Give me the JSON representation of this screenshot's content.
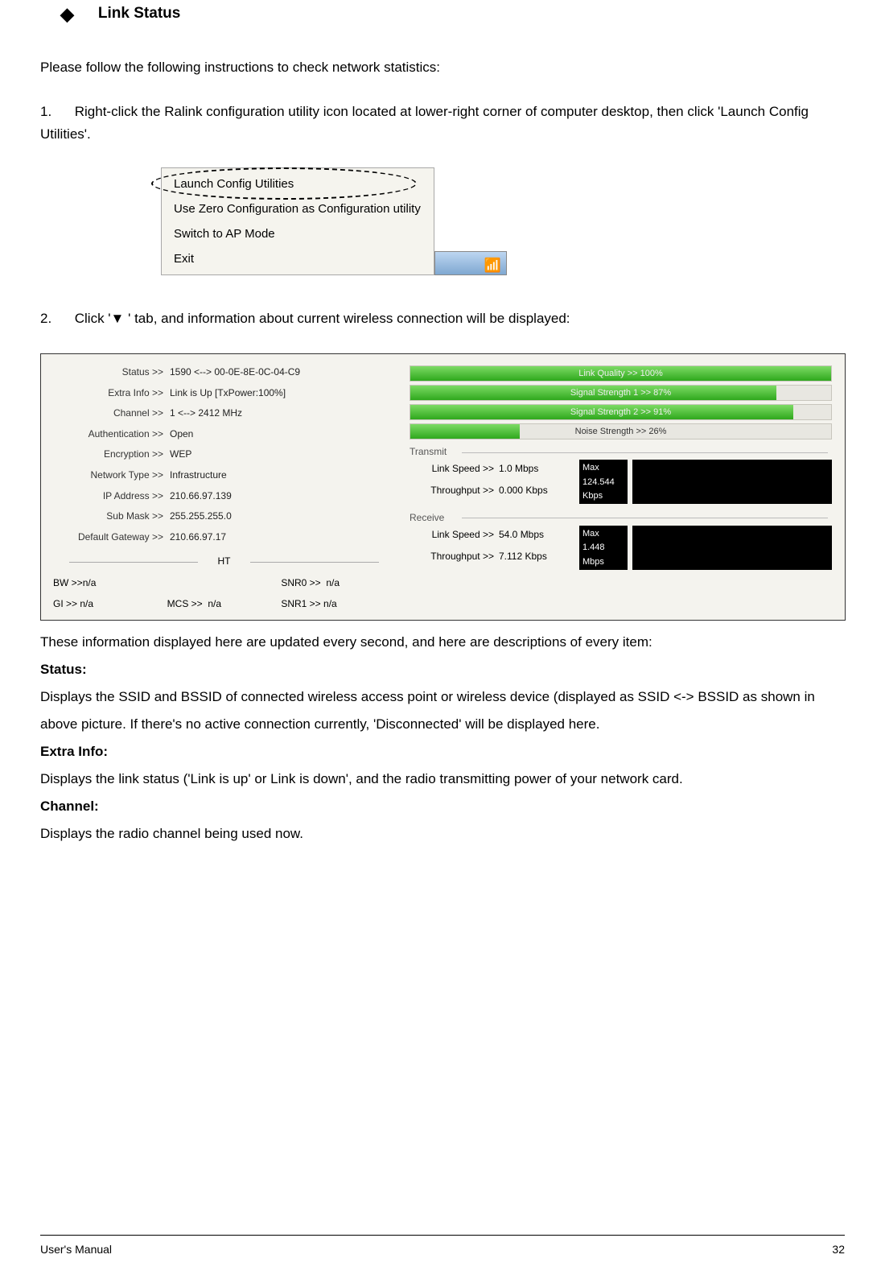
{
  "heading": "Link Status",
  "intro": "Please follow the following instructions to check network statistics:",
  "step1": "Right-click the Ralink configuration utility icon located at lower-right corner of computer desktop, then click 'Launch Config Utilities'.",
  "step2_before": "Click '",
  "step2_after": " ' tab, and information about current wireless connection will be displayed:",
  "context_menu": {
    "items": [
      "Launch Config Utilities",
      "Use Zero Configuration as Configuration utility",
      "Switch to AP Mode",
      "Exit"
    ],
    "tray_glyph": "📶"
  },
  "status_panel": {
    "left": [
      {
        "label": "Status >>",
        "value": "1590 <--> 00-0E-8E-0C-04-C9"
      },
      {
        "label": "Extra Info >>",
        "value": "Link is Up [TxPower:100%]"
      },
      {
        "label": "Channel >>",
        "value": "1 <--> 2412 MHz"
      },
      {
        "label": "Authentication >>",
        "value": "Open"
      },
      {
        "label": "Encryption >>",
        "value": "WEP"
      },
      {
        "label": "Network Type >>",
        "value": "Infrastructure"
      },
      {
        "label": "IP Address >>",
        "value": "210.66.97.139"
      },
      {
        "label": "Sub Mask >>",
        "value": "255.255.255.0"
      },
      {
        "label": "Default Gateway >>",
        "value": "210.66.97.17"
      }
    ],
    "ht_label": "HT",
    "ht": [
      {
        "label": "BW >>",
        "value": "n/a"
      },
      {
        "label": "SNR0 >>",
        "value": "n/a"
      },
      {
        "label": "GI >>",
        "value": "n/a"
      },
      {
        "label": "MCS >>",
        "value": "n/a"
      },
      {
        "label": "SNR1 >>",
        "value": "n/a"
      }
    ],
    "bars": [
      {
        "label": "Link Quality >> 100%",
        "pct": 100
      },
      {
        "label": "Signal Strength 1 >> 87%",
        "pct": 87
      },
      {
        "label": "Signal Strength 2 >> 91%",
        "pct": 91
      },
      {
        "label": "Noise Strength >> 26%",
        "pct": 26
      }
    ],
    "transmit_label": "Transmit",
    "receive_label": "Receive",
    "tx_speed_label": "Link Speed >>",
    "tx_speed": "1.0 Mbps",
    "tx_tp_label": "Throughput >>",
    "tx_tp": "0.000 Kbps",
    "tx_max_label": "Max",
    "tx_max": "124.544 Kbps",
    "rx_speed_label": "Link Speed >>",
    "rx_speed": "54.0 Mbps",
    "rx_tp_label": "Throughput >>",
    "rx_tp": "7.112 Kbps",
    "rx_max_label": "Max",
    "rx_max": "1.448 Mbps"
  },
  "post_intro": "These information displayed here are updated every second, and here are descriptions of every item:",
  "fields": [
    {
      "name": "Status:",
      "desc": "Displays the SSID and BSSID of connected wireless access point or wireless device (displayed as SSID <-> BSSID as shown in above picture.  If there's no active connection currently, 'Disconnected' will be displayed here."
    },
    {
      "name": "Extra Info:",
      "desc": "Displays the link status ('Link is up' or Link is down', and the radio transmitting power of your network card."
    },
    {
      "name": "Channel:",
      "desc": "Displays the radio channel being used now."
    }
  ],
  "footer_left": "User's Manual",
  "footer_right": "32"
}
